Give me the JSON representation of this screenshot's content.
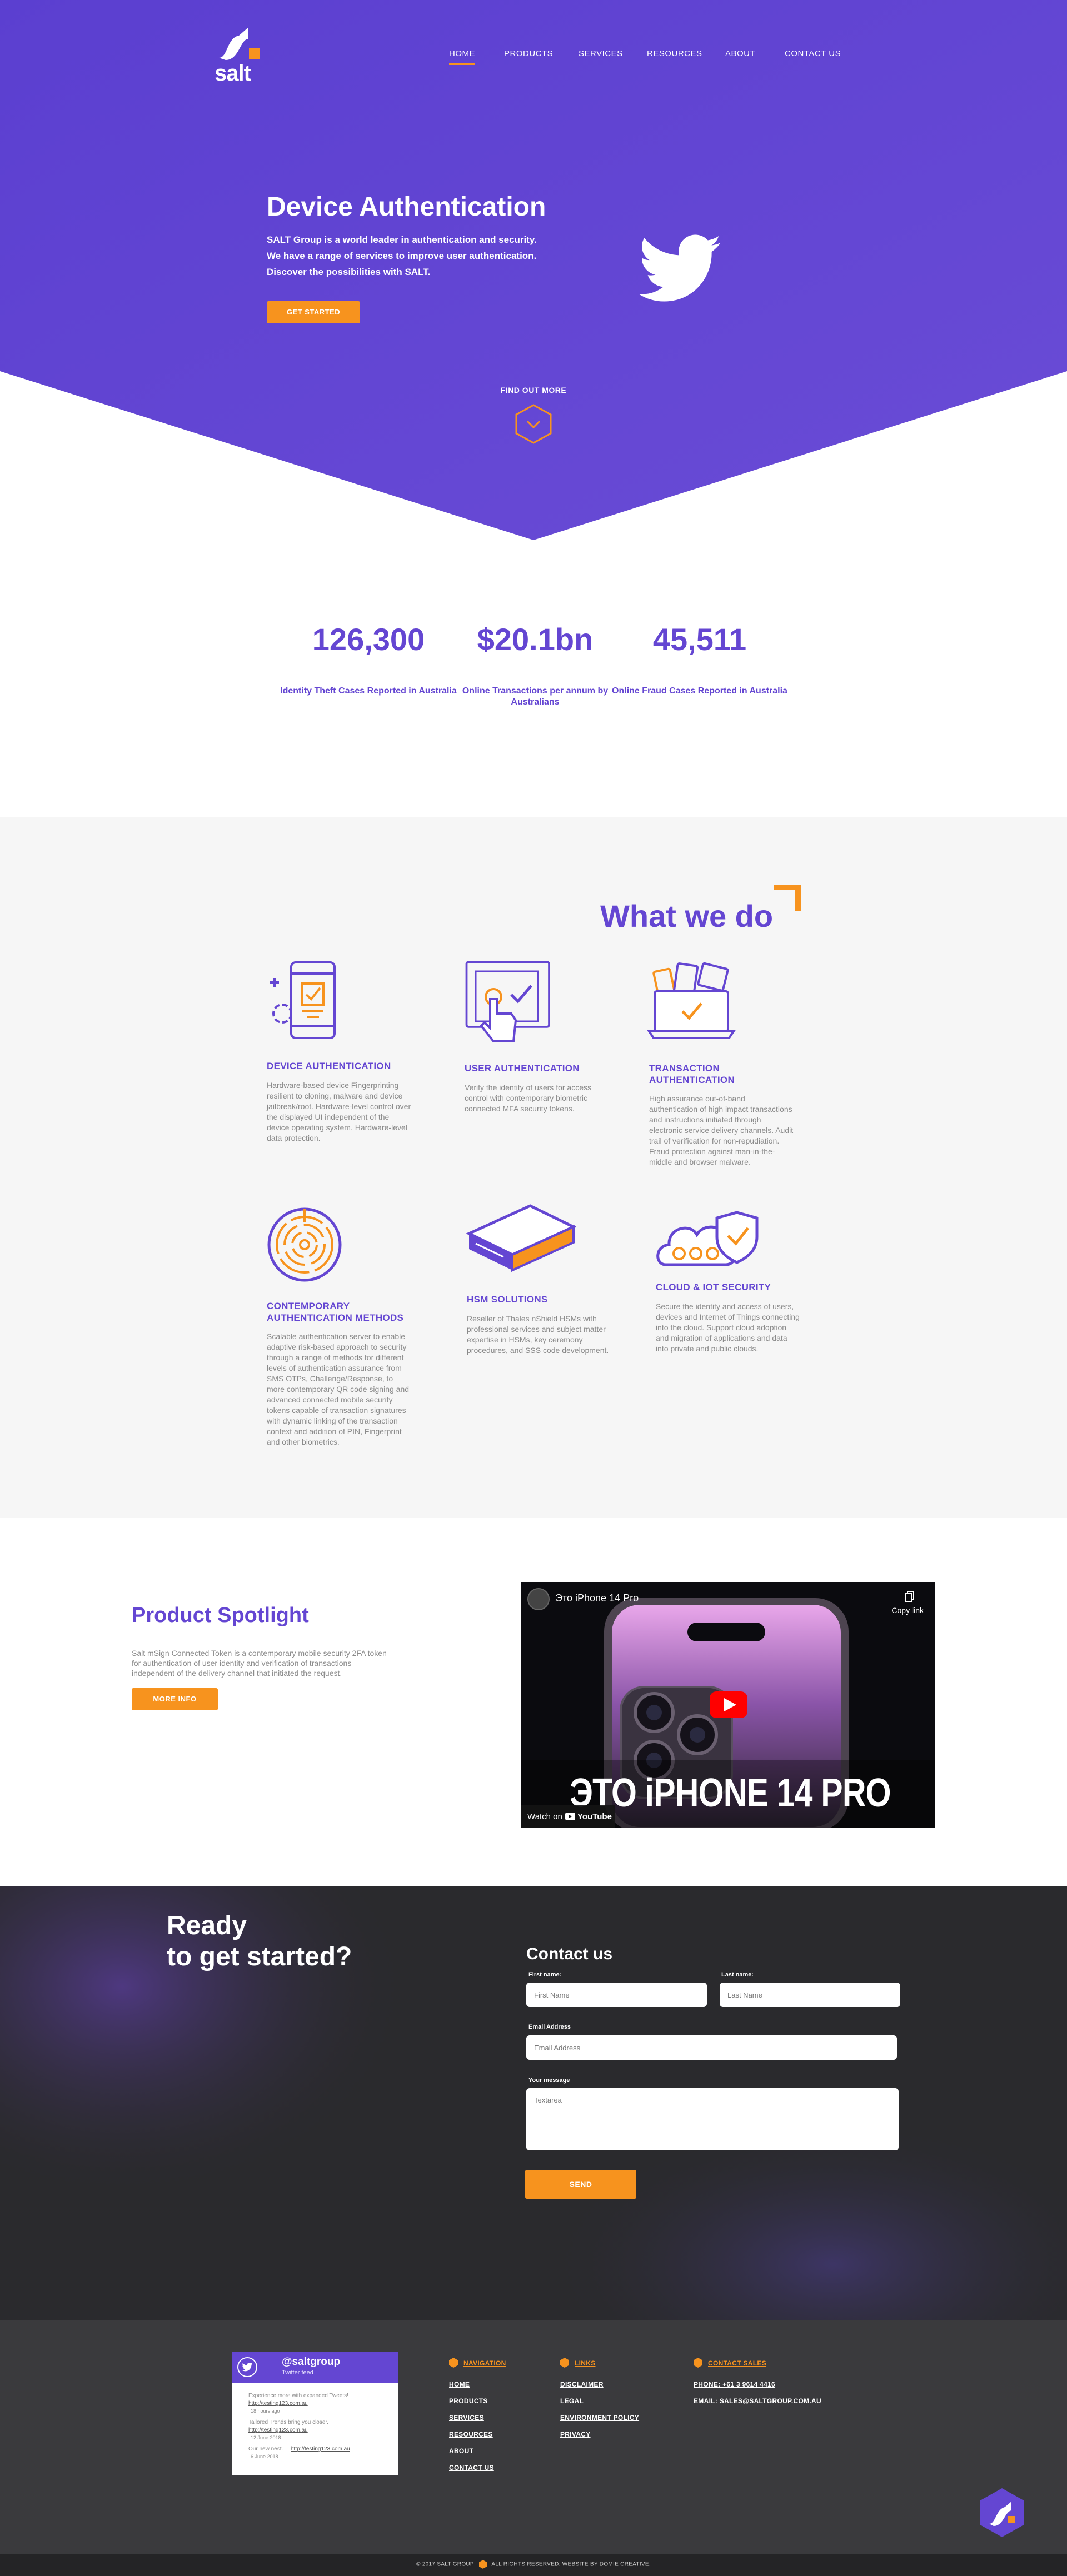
{
  "colors": {
    "brand_purple": "#6446d2",
    "accent_orange": "#f7931e",
    "dark_bg": "#2a2a2d",
    "footer_bg": "#3a3a3d"
  },
  "logo": {
    "text": "salt"
  },
  "nav": {
    "items": [
      {
        "label": "HOME",
        "active": true
      },
      {
        "label": "PRODUCTS"
      },
      {
        "label": "SERVICES"
      },
      {
        "label": "RESOURCES"
      },
      {
        "label": "ABOUT"
      },
      {
        "label": "CONTACT US"
      }
    ]
  },
  "hero": {
    "title": "Device Authentication",
    "lines": [
      "SALT Group is a world leader in authentication and security.",
      "We have a range of services to improve user authentication.",
      "Discover the possibilities with SALT."
    ],
    "cta": "GET STARTED",
    "find_more": "FIND OUT MORE",
    "icon": "twitter-bird-icon"
  },
  "stats": [
    {
      "value": "126,300",
      "label": "Identity Theft Cases Reported in Australia"
    },
    {
      "value": "$20.1bn",
      "label": "Online Transactions per annum by Australians"
    },
    {
      "value": "45,511",
      "label": "Online Fraud Cases Reported in Australia"
    }
  ],
  "what_we_do": {
    "title": "What we do",
    "services": [
      {
        "icon": "phone-fingerprint-icon",
        "title": "DEVICE AUTHENTICATION",
        "desc": "Hardware-based device Fingerprinting resilient to cloning, malware and device jailbreak/root. Hardware-level control over the displayed UI independent of the device operating system. Hardware-level data protection."
      },
      {
        "icon": "touch-screen-icon",
        "title": "USER AUTHENTICATION",
        "desc": "Verify the identity of users for access control with contemporary biometric connected MFA security tokens."
      },
      {
        "icon": "laptop-payment-icon",
        "title": "TRANSACTION AUTHENTICATION",
        "desc": "High assurance out-of-band authentication of high impact transactions and instructions initiated through electronic service delivery channels. Audit trail of verification for non-repudiation. Fraud protection against man-in-the-middle and browser malware."
      },
      {
        "icon": "maze-target-icon",
        "title": "CONTEMPORARY AUTHENTICATION METHODS",
        "desc": "Scalable authentication server to enable adaptive risk-based approach to security through a range of methods for different levels of authentication assurance from SMS OTPs, Challenge/Response, to more contemporary QR code signing and advanced connected mobile security tokens capable of transaction signatures with dynamic linking of the transaction context and addition of PIN, Fingerprint and other biometrics."
      },
      {
        "icon": "hsm-device-icon",
        "title": "HSM SOLUTIONS",
        "desc": "Reseller of Thales nShield HSMs with professional services and subject matter expertise in HSMs, key ceremony procedures, and SSS code development."
      },
      {
        "icon": "cloud-shield-icon",
        "title": "CLOUD & IOT SECURITY",
        "desc": "Secure the identity and access of users, devices and Internet of Things connecting into the cloud. Support cloud adoption and migration of applications and data into private and public clouds."
      }
    ]
  },
  "spotlight": {
    "title": "Product Spotlight",
    "desc": "Salt mSign Connected Token is a contemporary mobile security 2FA token for authentication of user identity and verification of transactions independent of the delivery channel that initiated the request.",
    "cta": "MORE INFO",
    "video": {
      "title": "Это iPhone 14 Pro",
      "copy_link": "Copy link",
      "overlay_text": "ЭТО  iPHONE 14 PRO",
      "watch_on": "Watch on",
      "platform": "YouTube"
    }
  },
  "contact": {
    "ready_line1": "Ready",
    "ready_line2": "to get started?",
    "title": "Contact us",
    "first_name_label": "First name:",
    "first_name_placeholder": "First Name",
    "last_name_label": "Last name:",
    "last_name_placeholder": "Last Name",
    "email_label": "Email Address",
    "email_placeholder": "Email Address",
    "message_label": "Your message",
    "message_placeholder": "Textarea",
    "send": "SEND"
  },
  "footer": {
    "twitter": {
      "handle": "@saltgroup",
      "sub": "Twitter feed",
      "tweets": [
        {
          "text": "Experience more with expanded Tweets!",
          "link": "http://testing123.com.au",
          "time": "18 hours ago"
        },
        {
          "text": "Tailored Trends bring you closer.",
          "link": "http://testing123.com.au",
          "time": "12 June 2018"
        },
        {
          "text": "Our new nest.",
          "link": "http://testing123.com.au",
          "time": "6 June 2018"
        }
      ]
    },
    "navigation": {
      "heading": "NAVIGATION",
      "links": [
        "HOME",
        "PRODUCTS",
        "SERVICES",
        "RESOURCES",
        "ABOUT",
        "CONTACT US"
      ]
    },
    "links": {
      "heading": "LINKS",
      "links": [
        "DISCLAIMER",
        "LEGAL",
        "ENVIRONMENT POLICY",
        "PRIVACY"
      ]
    },
    "contact_sales": {
      "heading": "CONTACT SALES",
      "phone": "PHONE: +61 3 9614 4416",
      "email": "EMAIL: SALES@SALTGROUP.COM.AU"
    },
    "copyright_left": "© 2017 SALT GROUP",
    "copyright_right": "ALL RIGHTS RESERVED. WEBSITE BY DOMIE CREATIVE."
  }
}
